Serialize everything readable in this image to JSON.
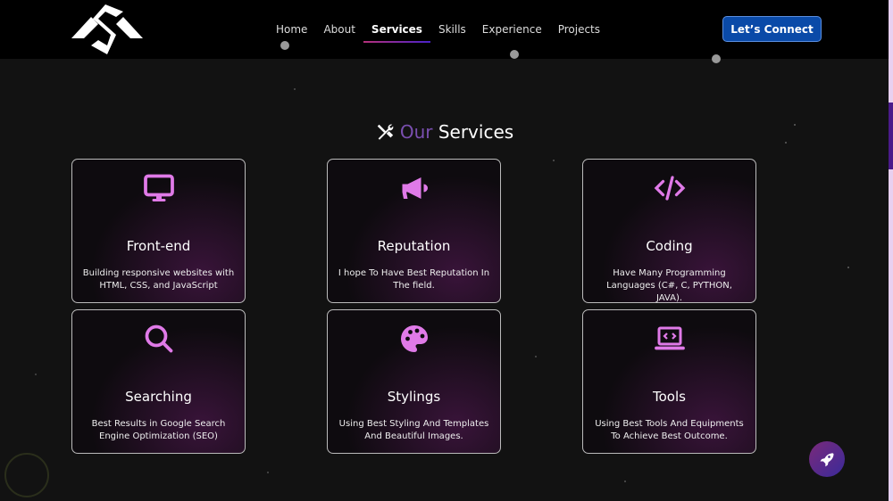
{
  "nav": {
    "items": [
      {
        "label": "Home"
      },
      {
        "label": "About"
      },
      {
        "label": "Services",
        "active": true
      },
      {
        "label": "Skills"
      },
      {
        "label": "Experience"
      },
      {
        "label": "Projects"
      }
    ],
    "cta": "Let’s Connect"
  },
  "section": {
    "title_accent": "Our",
    "title": "Services",
    "icon": "tools-icon",
    "accent_color": "#7a4fb0"
  },
  "cards": [
    {
      "title": "Front-end",
      "desc": "Building responsive websites with HTML, CSS, and JavaScript",
      "icon": "monitor-icon"
    },
    {
      "title": "Reputation",
      "desc": "I hope To Have Best Reputation In The field.",
      "icon": "megaphone-icon"
    },
    {
      "title": "Coding",
      "desc": "Have Many Programming Languages (C#, C, PYTHON, JAVA).",
      "icon": "code-icon"
    },
    {
      "title": "Searching",
      "desc": "Best Results in Google Search Engine Optimization (SEO)",
      "icon": "search-icon"
    },
    {
      "title": "Stylings",
      "desc": "Using Best Styling And Templates And Beautiful Images.",
      "icon": "palette-icon"
    },
    {
      "title": "Tools",
      "desc": "Using Best Tools And Equipments To Achieve Best Outcome.",
      "icon": "laptop-code-icon"
    }
  ],
  "colors": {
    "icon": "#e07ae8",
    "cta": "#0a4aa8",
    "background": "#121212"
  }
}
